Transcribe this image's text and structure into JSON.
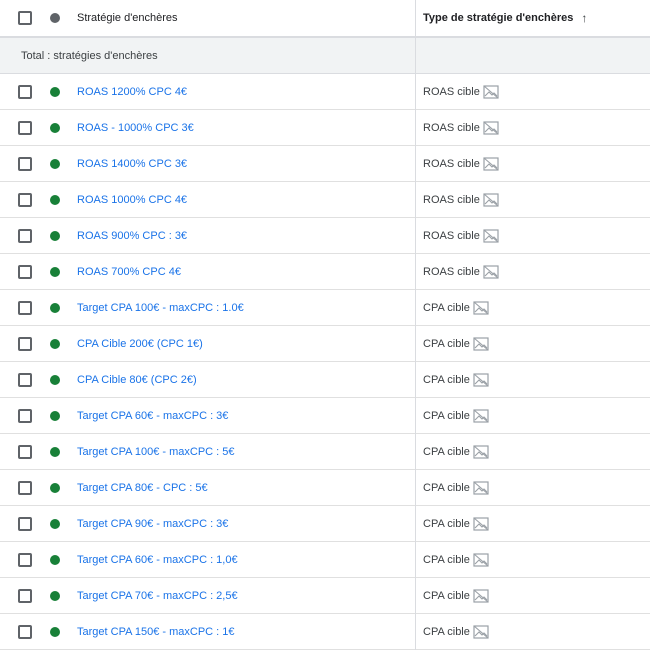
{
  "header": {
    "name_column": "Stratégie d'enchères",
    "type_column": "Type de stratégie d'enchères"
  },
  "total_row": {
    "label": "Total : stratégies d'enchères"
  },
  "rows": [
    {
      "name": "ROAS 1200% CPC 4€",
      "type": "ROAS cible"
    },
    {
      "name": "ROAS - 1000% CPC 3€",
      "type": "ROAS cible"
    },
    {
      "name": "ROAS 1400% CPC 3€",
      "type": "ROAS cible"
    },
    {
      "name": "ROAS 1000% CPC 4€",
      "type": "ROAS cible"
    },
    {
      "name": "ROAS 900% CPC : 3€",
      "type": "ROAS cible"
    },
    {
      "name": "ROAS 700% CPC 4€",
      "type": "ROAS cible"
    },
    {
      "name": "Target CPA 100€ - maxCPC : 1.0€",
      "type": "CPA cible"
    },
    {
      "name": "CPA Cible 200€ (CPC 1€)",
      "type": "CPA cible"
    },
    {
      "name": "CPA Cible 80€ (CPC 2€)",
      "type": "CPA cible"
    },
    {
      "name": "Target CPA 60€ - maxCPC : 3€",
      "type": "CPA cible"
    },
    {
      "name": "Target CPA 100€ - maxCPC : 5€",
      "type": "CPA cible"
    },
    {
      "name": "Target CPA 80€ - CPC : 5€",
      "type": "CPA cible"
    },
    {
      "name": "Target CPA 90€ - maxCPC : 3€",
      "type": "CPA cible"
    },
    {
      "name": "Target CPA 60€ - maxCPC : 1,0€",
      "type": "CPA cible"
    },
    {
      "name": "Target CPA 70€ - maxCPC : 2,5€",
      "type": "CPA cible"
    },
    {
      "name": "Target CPA 150€ - maxCPC : 1€",
      "type": "CPA cible"
    }
  ],
  "icons": {
    "status_header": "status-circle-icon",
    "status_enabled": "status-enabled-icon",
    "sort": "arrow-up-icon",
    "image_unavailable": "broken-image-icon"
  },
  "colors": {
    "link": "#1a73e8",
    "enabled": "#188038",
    "header_dot": "#5f6368"
  }
}
